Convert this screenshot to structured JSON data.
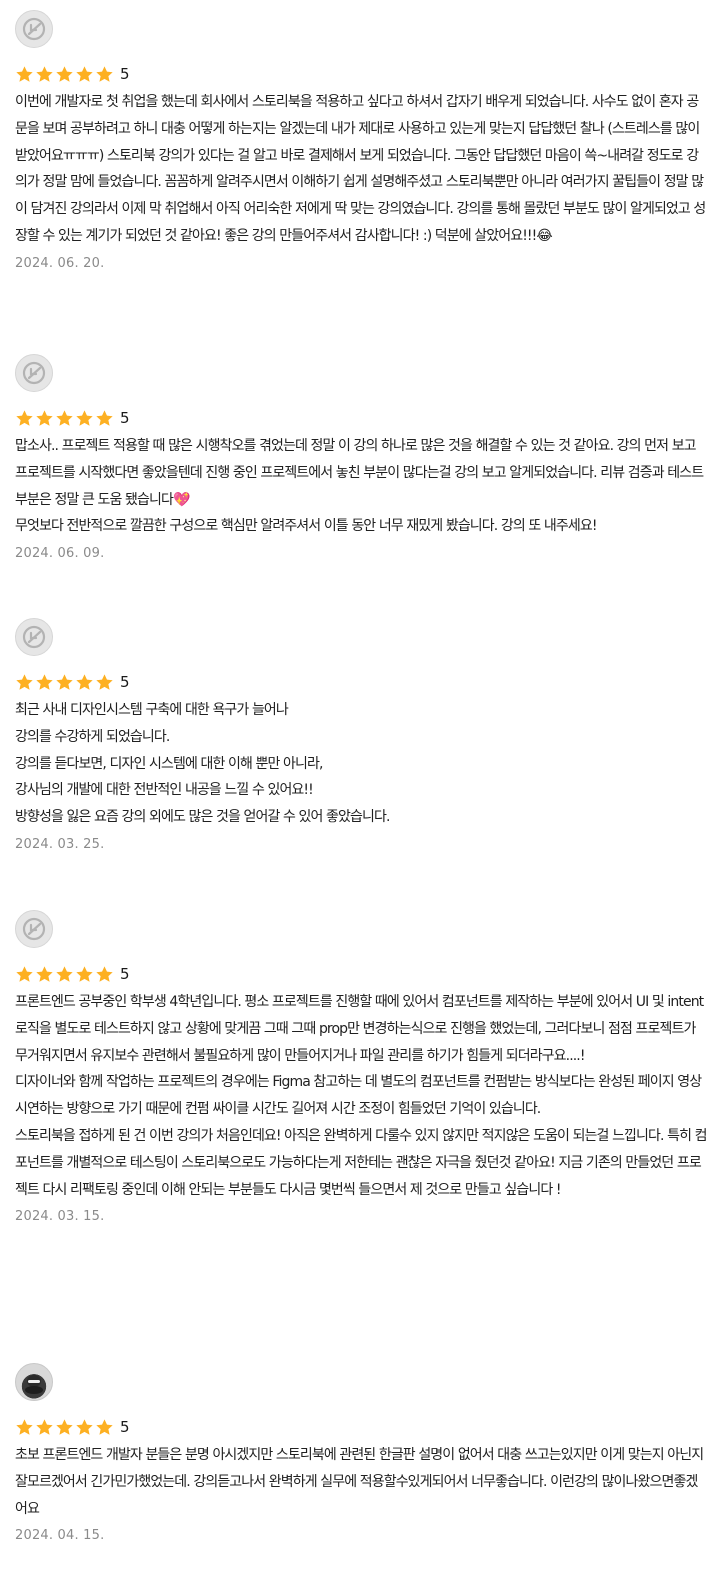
{
  "reviews": [
    {
      "avatar": "default-profile-icon",
      "rating": "5",
      "text": "이번에 개발자로 첫 취업을 했는데 회사에서 스토리북을 적용하고 싶다고 하셔서 갑자기 배우게 되었습니다. 사수도 없이 혼자 공문을 보며 공부하려고 하니 대충 어떻게 하는지는 알겠는데 내가 제대로 사용하고 있는게 맞는지 답답했던 찰나 (스트레스를 많이 받았어요ㅠㅠㅠ) 스토리북 강의가 있다는 걸 알고 바로 결제해서 보게 되었습니다. 그동안 답답했던 마음이 쓱~내려갈 정도로 강의가 정말 맘에 들었습니다. 꼼꼼하게 알려주시면서 이해하기 쉽게 설명해주셨고 스토리북뿐만 아니라 여러가지 꿀팁들이 정말 많이 담겨진 강의라서 이제 막 취업해서 아직 어리숙한 저에게 딱 맞는 강의였습니다. 강의를 통해 몰랐던 부분도 많이 알게되었고 성장할 수 있는 계기가 되었던 것 같아요! 좋은 강의 만들어주셔서 감사합니다! :) 덕분에 살았어요!!!😂",
      "date": "2024. 06. 20."
    },
    {
      "avatar": "default-profile-icon",
      "rating": "5",
      "text": "맙소사.. 프로젝트 적용할 때 많은 시행착오를 겪었는데 정말 이 강의 하나로 많은 것을 해결할 수 있는 것 같아요. 강의 먼저 보고 프로젝트를 시작했다면 좋았을텐데 진행 중인 프로젝트에서 놓친 부분이 많다는걸 강의 보고 알게되었습니다. 리뷰 검증과 테스트 부분은 정말 큰 도움 됐습니다💖\n무엇보다 전반적으로 깔끔한 구성으로 핵심만 알려주셔서 이틀 동안 너무 재밌게 봤습니다. 강의 또 내주세요!",
      "date": "2024. 06. 09."
    },
    {
      "avatar": "default-profile-icon",
      "rating": "5",
      "text": "최근 사내 디자인시스템 구축에 대한 욕구가 늘어나\n강의를 수강하게 되었습니다.\n강의를 듣다보면, 디자인 시스템에 대한 이해 뿐만 아니라,\n강사님의 개발에 대한 전반적인 내공을 느낄 수 있어요!!\n방향성을 잃은 요즘 강의 외에도 많은 것을 얻어갈 수 있어 좋았습니다.",
      "date": "2024. 03. 25."
    },
    {
      "avatar": "default-profile-icon",
      "rating": "5",
      "text": "프론트엔드 공부중인 학부생 4학년입니다. 평소 프로젝트를 진행할 때에 있어서 컴포넌트를 제작하는 부분에 있어서 UI 및 intent 로직을 별도로 테스트하지 않고 상황에 맞게끔 그때 그때 prop만 변경하는식으로 진행을 했었는데, 그러다보니 점점 프로젝트가 무거워지면서 유지보수 관련해서 불필요하게 많이 만들어지거나 파일 관리를 하기가 힘들게 되더라구요....!\n디자이너와 함께 작업하는 프로젝트의 경우에는 Figma 참고하는 데 별도의 컴포넌트를 컨펌받는 방식보다는 완성된 페이지 영상 시연하는 방향으로 가기 때문에 컨펌 싸이클 시간도 길어져 시간 조정이 힘들었던 기억이 있습니다.\n스토리북을 접하게 된 건 이번 강의가 처음인데요! 아직은 완벽하게 다룰수 있지 않지만 적지않은 도움이 되는걸 느낍니다. 특히 컴포넌트를 개별적으로 테스팅이 스토리북으로도 가능하다는게 저한테는 괜찮은 자극을 줬던것 같아요! 지금 기존의 만들었던 프로젝트 다시 리팩토링 중인데 이해 안되는 부분들도 다시금 몇번씩 들으면서 제 것으로 만들고 싶습니다 !",
      "date": "2024. 03. 15."
    },
    {
      "avatar": "user-photo-avatar",
      "rating": "5",
      "text": "초보 프론트엔드 개발자 분들은 분명 아시겠지만 스토리북에 관련된 한글판 설명이 없어서 대충 쓰고는있지만 이게 맞는지 아닌지 잘모르겠어서 긴가민가했었는데. 강의듣고나서 완벽하게 실무에 적용할수있게되어서 너무좋습니다. 이런강의 많이나왔으면좋겠어요",
      "date": "2024. 04. 15."
    }
  ],
  "colors": {
    "star": "#fdb022",
    "date": "#8a8a8a",
    "avatar_bg": "#e6e6e6",
    "avatar_icon": "#b3b3b3"
  }
}
